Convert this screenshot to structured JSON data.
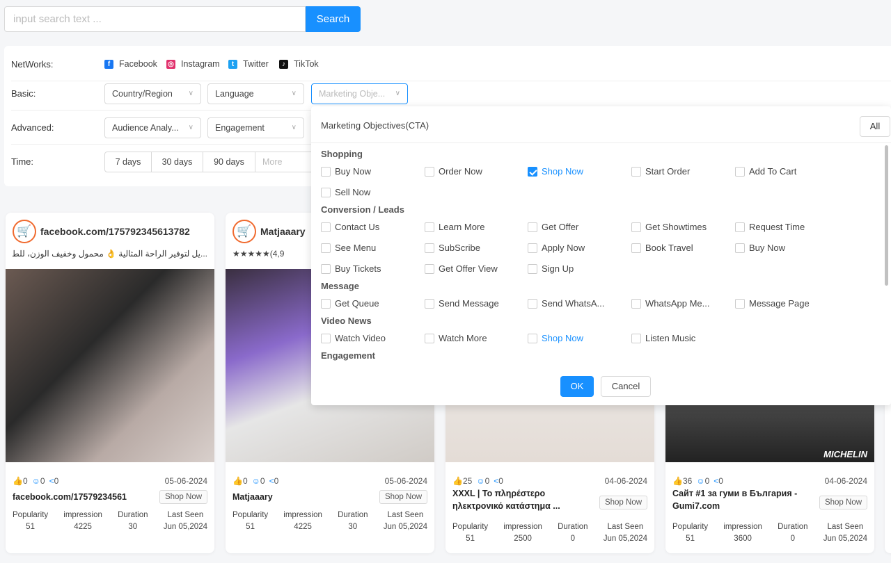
{
  "search": {
    "placeholder": "input search text ...",
    "button": "Search"
  },
  "filters": {
    "networks_label": "NetWorks:",
    "networks": [
      {
        "name": "Facebook",
        "color": "#1877f2",
        "glyph": "f"
      },
      {
        "name": "Instagram",
        "color": "#e1306c",
        "glyph": "◎"
      },
      {
        "name": "Twitter",
        "color": "#1da1f2",
        "glyph": "t"
      },
      {
        "name": "TikTok",
        "color": "#111111",
        "glyph": "♪"
      }
    ],
    "basic_label": "Basic:",
    "basic": [
      "Country/Region",
      "Language",
      "Marketing Obje..."
    ],
    "advanced_label": "Advanced:",
    "advanced": [
      "Audience Analy...",
      "Engagement"
    ],
    "time_label": "Time:",
    "time": [
      "7 days",
      "30 days",
      "90 days",
      "More"
    ]
  },
  "panel": {
    "title": "Marketing Objectives(CTA)",
    "all": "All",
    "ok": "OK",
    "cancel": "Cancel",
    "groups": [
      {
        "name": "Shopping",
        "options": [
          {
            "label": "Buy Now"
          },
          {
            "label": "Order Now"
          },
          {
            "label": "Shop Now",
            "checked": true
          },
          {
            "label": "Start Order"
          },
          {
            "label": "Add To Cart"
          },
          {
            "label": "Sell Now"
          }
        ]
      },
      {
        "name": "Conversion / Leads",
        "options": [
          {
            "label": "Contact Us"
          },
          {
            "label": "Learn More"
          },
          {
            "label": "Get Offer"
          },
          {
            "label": "Get Showtimes"
          },
          {
            "label": "Request Time"
          },
          {
            "label": "See Menu"
          },
          {
            "label": "SubScribe"
          },
          {
            "label": "Apply Now"
          },
          {
            "label": "Book Travel"
          },
          {
            "label": "Buy Now"
          },
          {
            "label": "Buy Tickets"
          },
          {
            "label": "Get Offer View"
          },
          {
            "label": "Sign Up"
          }
        ]
      },
      {
        "name": "Message",
        "options": [
          {
            "label": "Get Queue"
          },
          {
            "label": "Send Message"
          },
          {
            "label": "Send WhatsA..."
          },
          {
            "label": "WhatsApp Me..."
          },
          {
            "label": "Message Page"
          }
        ]
      },
      {
        "name": "Video News",
        "options": [
          {
            "label": "Watch Video"
          },
          {
            "label": "Watch More"
          },
          {
            "label": "Shop Now",
            "highlight": true
          },
          {
            "label": "Listen Music"
          }
        ]
      },
      {
        "name": "Engagement",
        "options": []
      }
    ]
  },
  "metric_labels": [
    "Popularity",
    "impression",
    "Duration",
    "Last Seen"
  ],
  "cards": [
    {
      "advertiser": "facebook.com/175792345613782",
      "desc": "...يل لتوفير الراحة المثالية 👌 محمول وخفيف الوزن، للطلب 🚀",
      "likes": "0",
      "comments": "0",
      "shares": "0",
      "date": "05-06-2024",
      "title": "facebook.com/17579234561",
      "cta": "Shop Now",
      "popularity": "51",
      "impression": "4225",
      "duration": "30",
      "last_seen": "Jun 05,2024"
    },
    {
      "advertiser": "Matjaaary",
      "desc": "★★★★★(4,9",
      "likes": "0",
      "comments": "0",
      "shares": "0",
      "date": "05-06-2024",
      "title": "Matjaaary",
      "cta": "Shop Now",
      "popularity": "51",
      "impression": "4225",
      "duration": "30",
      "last_seen": "Jun 05,2024"
    },
    {
      "likes": "25",
      "comments": "0",
      "shares": "0",
      "date": "04-06-2024",
      "title": "XXXL | Το πληρέστερο ηλεκτρονικό κατάστημα ...",
      "cta": "Shop Now",
      "popularity": "51",
      "impression": "2500",
      "duration": "0",
      "last_seen": "Jun 05,2024"
    },
    {
      "likes": "36",
      "comments": "0",
      "shares": "0",
      "date": "04-06-2024",
      "title": "Сайт #1 за гуми в България - Gumi7.com",
      "cta": "Shop Now",
      "popularity": "51",
      "impression": "3600",
      "duration": "0",
      "last_seen": "Jun 05,2024",
      "image_logo": "MICHELIN"
    }
  ]
}
